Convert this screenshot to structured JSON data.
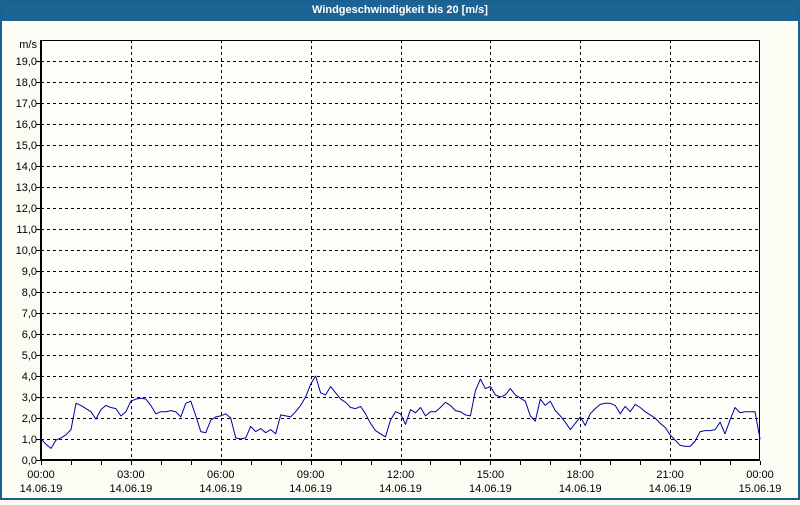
{
  "window": {
    "title": "Windgeschwindigkeit bis 20 [m/s]"
  },
  "chart_data": {
    "type": "line",
    "title": "Windgeschwindigkeit bis 20 [m/s]",
    "unit_label": "m/s",
    "ylim": [
      0,
      20
    ],
    "y_tick_step": 1.0,
    "y_tick_labels": [
      "0,0",
      "1,0",
      "2,0",
      "3,0",
      "4,0",
      "5,0",
      "6,0",
      "7,0",
      "8,0",
      "9,0",
      "10,0",
      "11,0",
      "12,0",
      "13,0",
      "14,0",
      "15,0",
      "16,0",
      "17,0",
      "18,0",
      "19,0"
    ],
    "x_axis": {
      "hours": 24,
      "minor_tick_every_hours": 1,
      "grid_every_hours": 3
    },
    "x_ticks": [
      {
        "hour": 0,
        "time": "00:00",
        "date": "14.06.19"
      },
      {
        "hour": 3,
        "time": "03:00",
        "date": "14.06.19"
      },
      {
        "hour": 6,
        "time": "06:00",
        "date": "14.06.19"
      },
      {
        "hour": 9,
        "time": "09:00",
        "date": "14.06.19"
      },
      {
        "hour": 12,
        "time": "12:00",
        "date": "14.06.19"
      },
      {
        "hour": 15,
        "time": "15:00",
        "date": "14.06.19"
      },
      {
        "hour": 18,
        "time": "18:00",
        "date": "14.06.19"
      },
      {
        "hour": 21,
        "time": "21:00",
        "date": "14.06.19"
      },
      {
        "hour": 24,
        "time": "00:00",
        "date": "15.06.19"
      }
    ],
    "interval_minutes": 10,
    "legend": "none",
    "grid": "dashed",
    "colors": {
      "titlebar": "#1d6394",
      "frame_border": "#1c608f",
      "background": "#fcfcf5",
      "plot_background": "#fefefa",
      "grid": "#000000",
      "line": "#0000a0"
    },
    "values": [
      1.0,
      0.75,
      0.55,
      0.95,
      1.05,
      1.2,
      1.45,
      2.7,
      2.6,
      2.45,
      2.3,
      1.95,
      2.4,
      2.6,
      2.5,
      2.45,
      2.1,
      2.3,
      2.8,
      2.9,
      2.95,
      2.9,
      2.6,
      2.2,
      2.3,
      2.3,
      2.35,
      2.3,
      2.05,
      2.7,
      2.8,
      2.1,
      1.35,
      1.3,
      1.9,
      2.05,
      2.1,
      2.2,
      2.0,
      1.05,
      1.0,
      1.05,
      1.6,
      1.35,
      1.5,
      1.3,
      1.45,
      1.25,
      2.15,
      2.1,
      2.05,
      2.3,
      2.6,
      3.0,
      3.6,
      4.0,
      3.2,
      3.1,
      3.5,
      3.2,
      2.9,
      2.75,
      2.5,
      2.45,
      2.55,
      2.2,
      1.75,
      1.4,
      1.25,
      1.1,
      1.9,
      2.3,
      2.2,
      1.7,
      2.4,
      2.25,
      2.5,
      2.1,
      2.3,
      2.3,
      2.5,
      2.75,
      2.6,
      2.35,
      2.3,
      2.15,
      2.1,
      3.3,
      3.85,
      3.4,
      3.5,
      3.1,
      3.0,
      3.1,
      3.4,
      3.1,
      2.95,
      2.8,
      2.1,
      1.85,
      2.9,
      2.6,
      2.8,
      2.35,
      2.1,
      1.8,
      1.45,
      1.75,
      2.05,
      1.65,
      2.2,
      2.45,
      2.65,
      2.7,
      2.7,
      2.6,
      2.2,
      2.55,
      2.3,
      2.65,
      2.5,
      2.3,
      2.15,
      2.0,
      1.75,
      1.55,
      1.2,
      0.95,
      0.7,
      0.65,
      0.65,
      0.9,
      1.35,
      1.4,
      1.4,
      1.45,
      1.8,
      1.25,
      1.9,
      2.5,
      2.25,
      2.3,
      2.3,
      2.3,
      1.0
    ]
  }
}
